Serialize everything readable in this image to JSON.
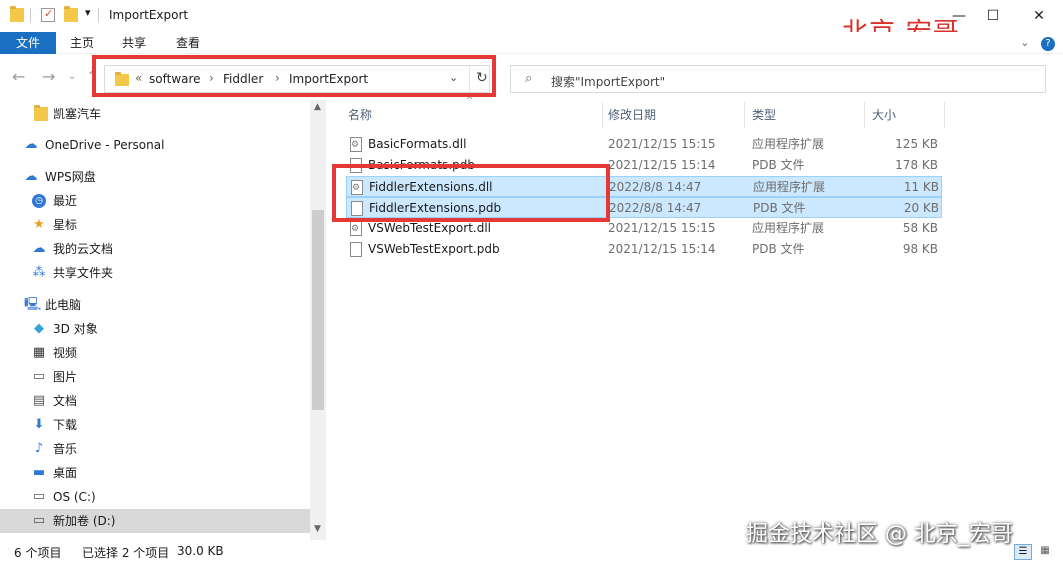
{
  "window": {
    "title": "ImportExport",
    "brand_text": "北京-宏哥"
  },
  "ribbon": {
    "tabs": [
      {
        "label": "文件"
      },
      {
        "label": "主页"
      },
      {
        "label": "共享"
      },
      {
        "label": "查看"
      }
    ]
  },
  "address": {
    "overflow": "«",
    "crumbs": [
      "software",
      "Fiddler",
      "ImportExport"
    ]
  },
  "search": {
    "placeholder": "搜索\"ImportExport\""
  },
  "sidebar": {
    "items": [
      {
        "label": "凯塞汽车",
        "icon": "folder-icon"
      },
      {
        "label": "OneDrive - Personal",
        "icon": "cloud-icon"
      },
      {
        "label": "WPS网盘",
        "icon": "cloud-icon"
      },
      {
        "label": "最近",
        "icon": "clock-icon"
      },
      {
        "label": "星标",
        "icon": "star-icon"
      },
      {
        "label": "我的云文档",
        "icon": "cloud-icon"
      },
      {
        "label": "共享文件夹",
        "icon": "share-icon"
      },
      {
        "label": "此电脑",
        "icon": "computer-icon"
      },
      {
        "label": "3D 对象",
        "icon": "cube-icon"
      },
      {
        "label": "视频",
        "icon": "video-icon"
      },
      {
        "label": "图片",
        "icon": "picture-icon"
      },
      {
        "label": "文档",
        "icon": "document-icon"
      },
      {
        "label": "下载",
        "icon": "download-icon"
      },
      {
        "label": "音乐",
        "icon": "music-icon"
      },
      {
        "label": "桌面",
        "icon": "desktop-icon"
      },
      {
        "label": "OS (C:)",
        "icon": "drive-icon"
      },
      {
        "label": "新加卷 (D:)",
        "icon": "drive-icon"
      }
    ]
  },
  "filelist": {
    "columns": [
      "名称",
      "修改日期",
      "类型",
      "大小"
    ],
    "rows": [
      {
        "name": "BasicFormats.dll",
        "date": "2021/12/15 15:15",
        "type": "应用程序扩展",
        "size": "125 KB",
        "icon": "dll-icon",
        "selected": false
      },
      {
        "name": "BasicFormats.pdb",
        "date": "2021/12/15 15:14",
        "type": "PDB 文件",
        "size": "178 KB",
        "icon": "file-icon",
        "selected": false
      },
      {
        "name": "FiddlerExtensions.dll",
        "date": "2022/8/8 14:47",
        "type": "应用程序扩展",
        "size": "11 KB",
        "icon": "dll-icon",
        "selected": true
      },
      {
        "name": "FiddlerExtensions.pdb",
        "date": "2022/8/8 14:47",
        "type": "PDB 文件",
        "size": "20 KB",
        "icon": "file-icon",
        "selected": true
      },
      {
        "name": "VSWebTestExport.dll",
        "date": "2021/12/15 15:15",
        "type": "应用程序扩展",
        "size": "58 KB",
        "icon": "dll-icon",
        "selected": false
      },
      {
        "name": "VSWebTestExport.pdb",
        "date": "2021/12/15 15:14",
        "type": "PDB 文件",
        "size": "98 KB",
        "icon": "file-icon",
        "selected": false
      }
    ]
  },
  "status": {
    "count": "6 个项目",
    "selected": "已选择 2 个项目",
    "size": "30.0 KB"
  },
  "watermark": "掘金技术社区 @ 北京_宏哥",
  "colors": {
    "accent": "#1a6fc2",
    "highlight_red": "#e53935",
    "selection": "#cce8ff"
  }
}
